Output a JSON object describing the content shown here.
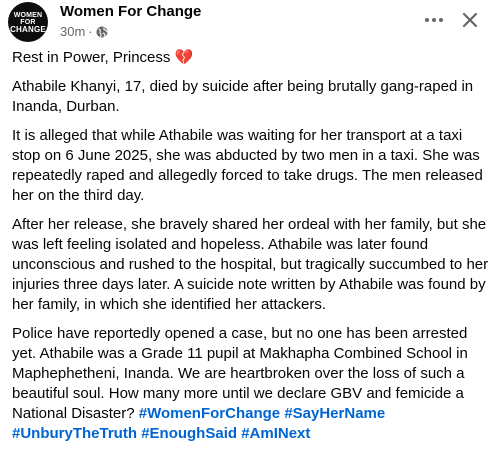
{
  "post": {
    "page_name": "Women For Change",
    "avatar_text_line1": "WOMEN FOR",
    "avatar_text_line2": "CHANGE",
    "time": "30m",
    "separator": "·",
    "audience_icon": "globe-icon",
    "more_icon": "more-dots-icon",
    "close_icon": "close-icon",
    "paragraphs": [
      "Rest in Power, Princess",
      "Athabile Khanyi, 17, died by suicide after being brutally gang-raped in Inanda, Durban.",
      "It is alleged that while Athabile was waiting for her transport at a taxi stop on 6 June 2025, she was abducted by two men in a taxi. She was repeatedly raped and allegedly forced to take drugs. The men released her on the third day.",
      "After her release, she bravely shared her ordeal with her family, but she was left feeling isolated and hopeless. Athabile was later found unconscious and rushed to the hospital, but tragically succumbed to her injuries three days later. A suicide note written by Athabile was found by her family, in which she identified her attackers.",
      "Police have reportedly opened a case, but no one has been arrested yet. Athabile was a Grade 11 pupil at Makhapha Combined School in Maphephetheni, Inanda. We are heartbroken over the loss of such a beautiful soul. How many more until we declare GBV and femicide a National Disaster?"
    ],
    "heart_emoji": "💔",
    "hashtags": [
      "#WomenForChange",
      "#SayHerName",
      "#UnburyTheTruth",
      "#EnoughSaid",
      "#AmINext"
    ],
    "colors": {
      "text": "#050505",
      "secondary": "#65676b",
      "hashtag": "#0064d1",
      "heart": "#e0245e"
    }
  }
}
